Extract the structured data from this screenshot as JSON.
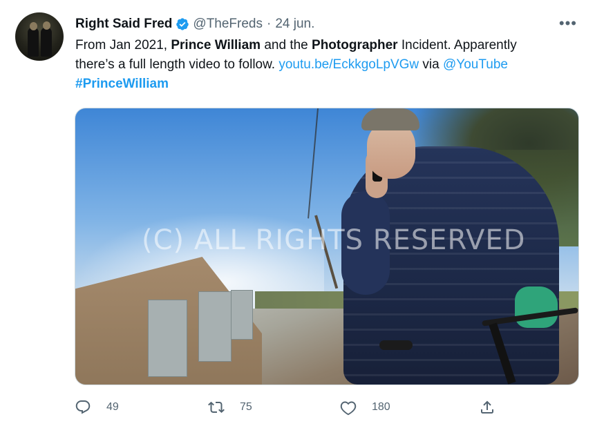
{
  "tweet": {
    "author_name": "Right Said Fred",
    "handle": "@TheFreds",
    "separator": "·",
    "date": "24 jun.",
    "more_label": "•••",
    "text": {
      "l1_a": "From Jan 2021, ",
      "l1_b": "Prince William",
      "l1_c": " and the ",
      "l1_d": "Photographer",
      "l1_e": " Incident. Apparently",
      "l2_a": "there’s a full length video to follow. ",
      "l2_link": "youtu.be/EckkgoLpVGw",
      "l2_c": " via ",
      "l2_mention": "@YouTube",
      "l3_hashtag": "#PrinceWilliam"
    },
    "media": {
      "watermark": "(C) ALL RIGHTS RESERVED"
    },
    "actions": {
      "reply_count": "49",
      "retweet_count": "75",
      "like_count": "180"
    }
  },
  "colors": {
    "link": "#1d9bf0",
    "secondary_text": "#536471",
    "primary_text": "#0f1419",
    "verified": "#1d9bf0"
  },
  "icons": {
    "verified": "verified-badge-icon",
    "more": "more-dots-icon",
    "reply": "reply-icon",
    "retweet": "retweet-icon",
    "like": "heart-icon",
    "share": "share-icon"
  }
}
